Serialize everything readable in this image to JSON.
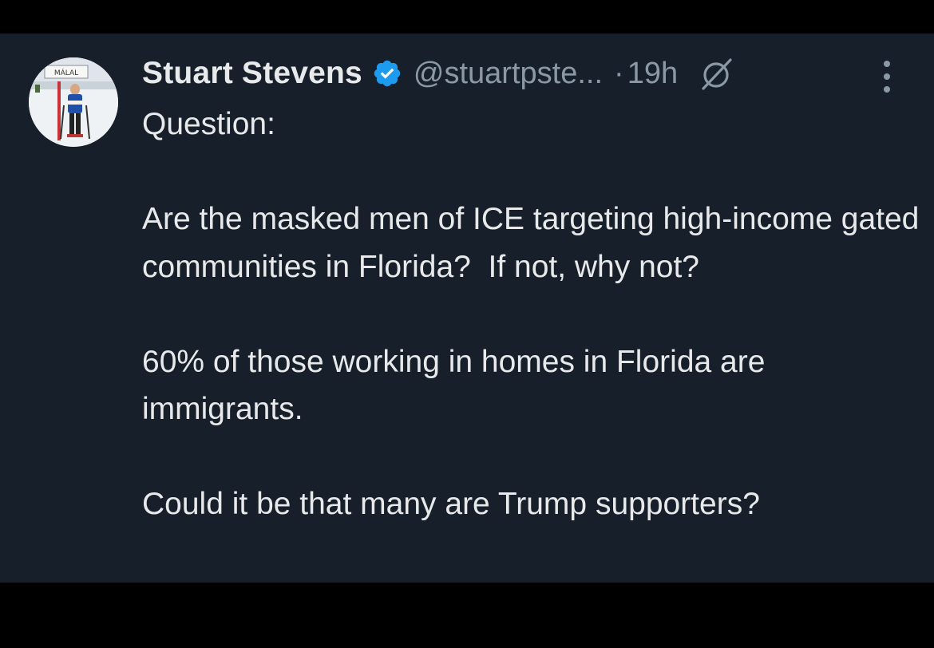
{
  "tweet": {
    "author": {
      "display_name": "Stuart Stevens",
      "handle": "@stuartpste...",
      "verified": true,
      "avatar_sign_text": "MÁLAL"
    },
    "separator": "·",
    "time": "19h",
    "paragraphs": [
      "Question:",
      "Are the masked men of ICE targeting high-income gated communities in Florida?  If not, why not?",
      "60% of those working in homes in Florida are immigrants.",
      "Could it be that many are Trump supporters?"
    ]
  },
  "icons": {
    "verified": "verified-badge-icon",
    "grok": "grok-icon",
    "more": "more-options-icon"
  },
  "colors": {
    "background": "#17202a",
    "text": "#e7e9ea",
    "secondary_text": "#8b98a5",
    "verified_badge": "#1d9bf0"
  }
}
